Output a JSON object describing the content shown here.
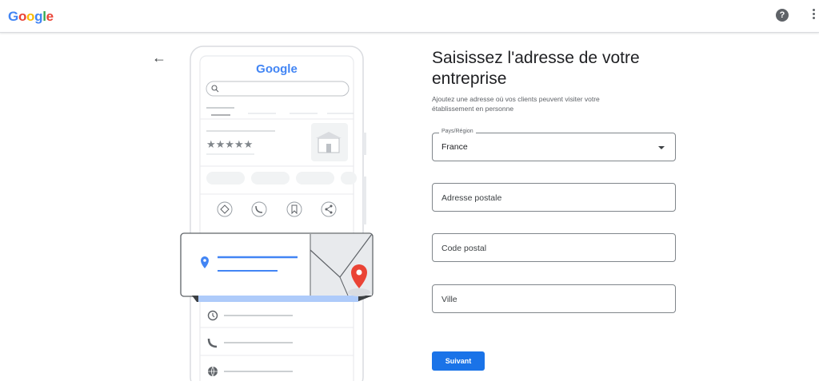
{
  "header": {
    "logo_letters": [
      {
        "ch": "G",
        "color": "#4285F4"
      },
      {
        "ch": "o",
        "color": "#EA4335"
      },
      {
        "ch": "o",
        "color": "#FBBC05"
      },
      {
        "ch": "g",
        "color": "#4285F4"
      },
      {
        "ch": "l",
        "color": "#34A853"
      },
      {
        "ch": "e",
        "color": "#EA4335"
      }
    ],
    "help_symbol": "?",
    "help_icon": "help-circle-icon",
    "menu_icon": "more-vert-icon"
  },
  "nav": {
    "back_symbol": "←",
    "back_icon": "arrow-left-icon"
  },
  "illustration": {
    "logo_text": "Google",
    "stars": "★★★★★",
    "action_icons": [
      "directions-icon",
      "phone-icon",
      "bookmark-icon",
      "share-icon"
    ],
    "detail_icons": [
      "clock-icon",
      "phone-icon",
      "globe-icon"
    ]
  },
  "form": {
    "title": "Saisissez l'adresse de votre entreprise",
    "subtitle_line1": "Ajoutez une adresse où vos clients peuvent visiter votre",
    "subtitle_line2": "établissement en personne",
    "country": {
      "label": "Pays/Région",
      "value": "France"
    },
    "address": {
      "placeholder": "Adresse postale"
    },
    "postal_code": {
      "placeholder": "Code postal"
    },
    "city": {
      "placeholder": "Ville"
    },
    "next_button": "Suivant"
  },
  "colors": {
    "primary": "#1a73e8",
    "pin_red": "#EA4335",
    "pin_blue": "#4285F4"
  }
}
